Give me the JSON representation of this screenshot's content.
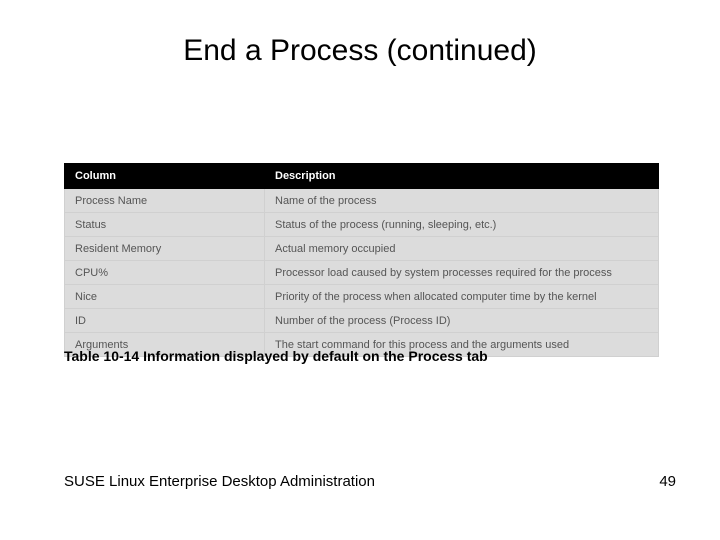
{
  "title": "End a Process (continued)",
  "caption": "Table 10-14 Information displayed by default on the Process tab",
  "footer": {
    "left": "SUSE Linux Enterprise Desktop Administration",
    "page": "49"
  },
  "chart_data": {
    "type": "table",
    "title": "Table 10-14 Information displayed by default on the Process tab",
    "headers": [
      "Column",
      "Description"
    ],
    "rows": [
      [
        "Process Name",
        "Name of the process"
      ],
      [
        "Status",
        "Status of the process (running, sleeping, etc.)"
      ],
      [
        "Resident Memory",
        "Actual memory occupied"
      ],
      [
        "CPU%",
        "Processor load caused by system processes required for the process"
      ],
      [
        "Nice",
        "Priority of the process when allocated computer time by the kernel"
      ],
      [
        "ID",
        "Number of the process (Process ID)"
      ],
      [
        "Arguments",
        "The start command for this process and the arguments used"
      ]
    ]
  }
}
